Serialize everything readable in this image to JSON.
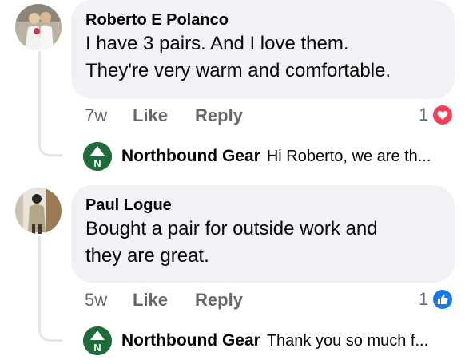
{
  "comments": [
    {
      "author": "Roberto E Polanco",
      "text_line1": "I have 3 pairs. And I love them.",
      "text_line2": "They're very warm and comfortable.",
      "time": "7w",
      "like_label": "Like",
      "reply_label": "Reply",
      "reaction_count": "1",
      "reaction_type": "heart-icon",
      "reaction_color": "#f33e58",
      "reply": {
        "author": "Northbound Gear",
        "snippet": "Hi Roberto, we are th..."
      }
    },
    {
      "author": "Paul Logue",
      "text_line1": "Bought a pair for outside work and",
      "text_line2": "they are great.",
      "time": "5w",
      "like_label": "Like",
      "reply_label": "Reply",
      "reaction_count": "1",
      "reaction_type": "thumbs-up-icon",
      "reaction_color": "#1877f2",
      "reply": {
        "author": "Northbound Gear",
        "snippet": "Thank you so much f..."
      }
    }
  ],
  "colors": {
    "bubble": "#f0f2f5",
    "secondary_text": "#65676b",
    "page_logo": "#1f6b3a"
  }
}
